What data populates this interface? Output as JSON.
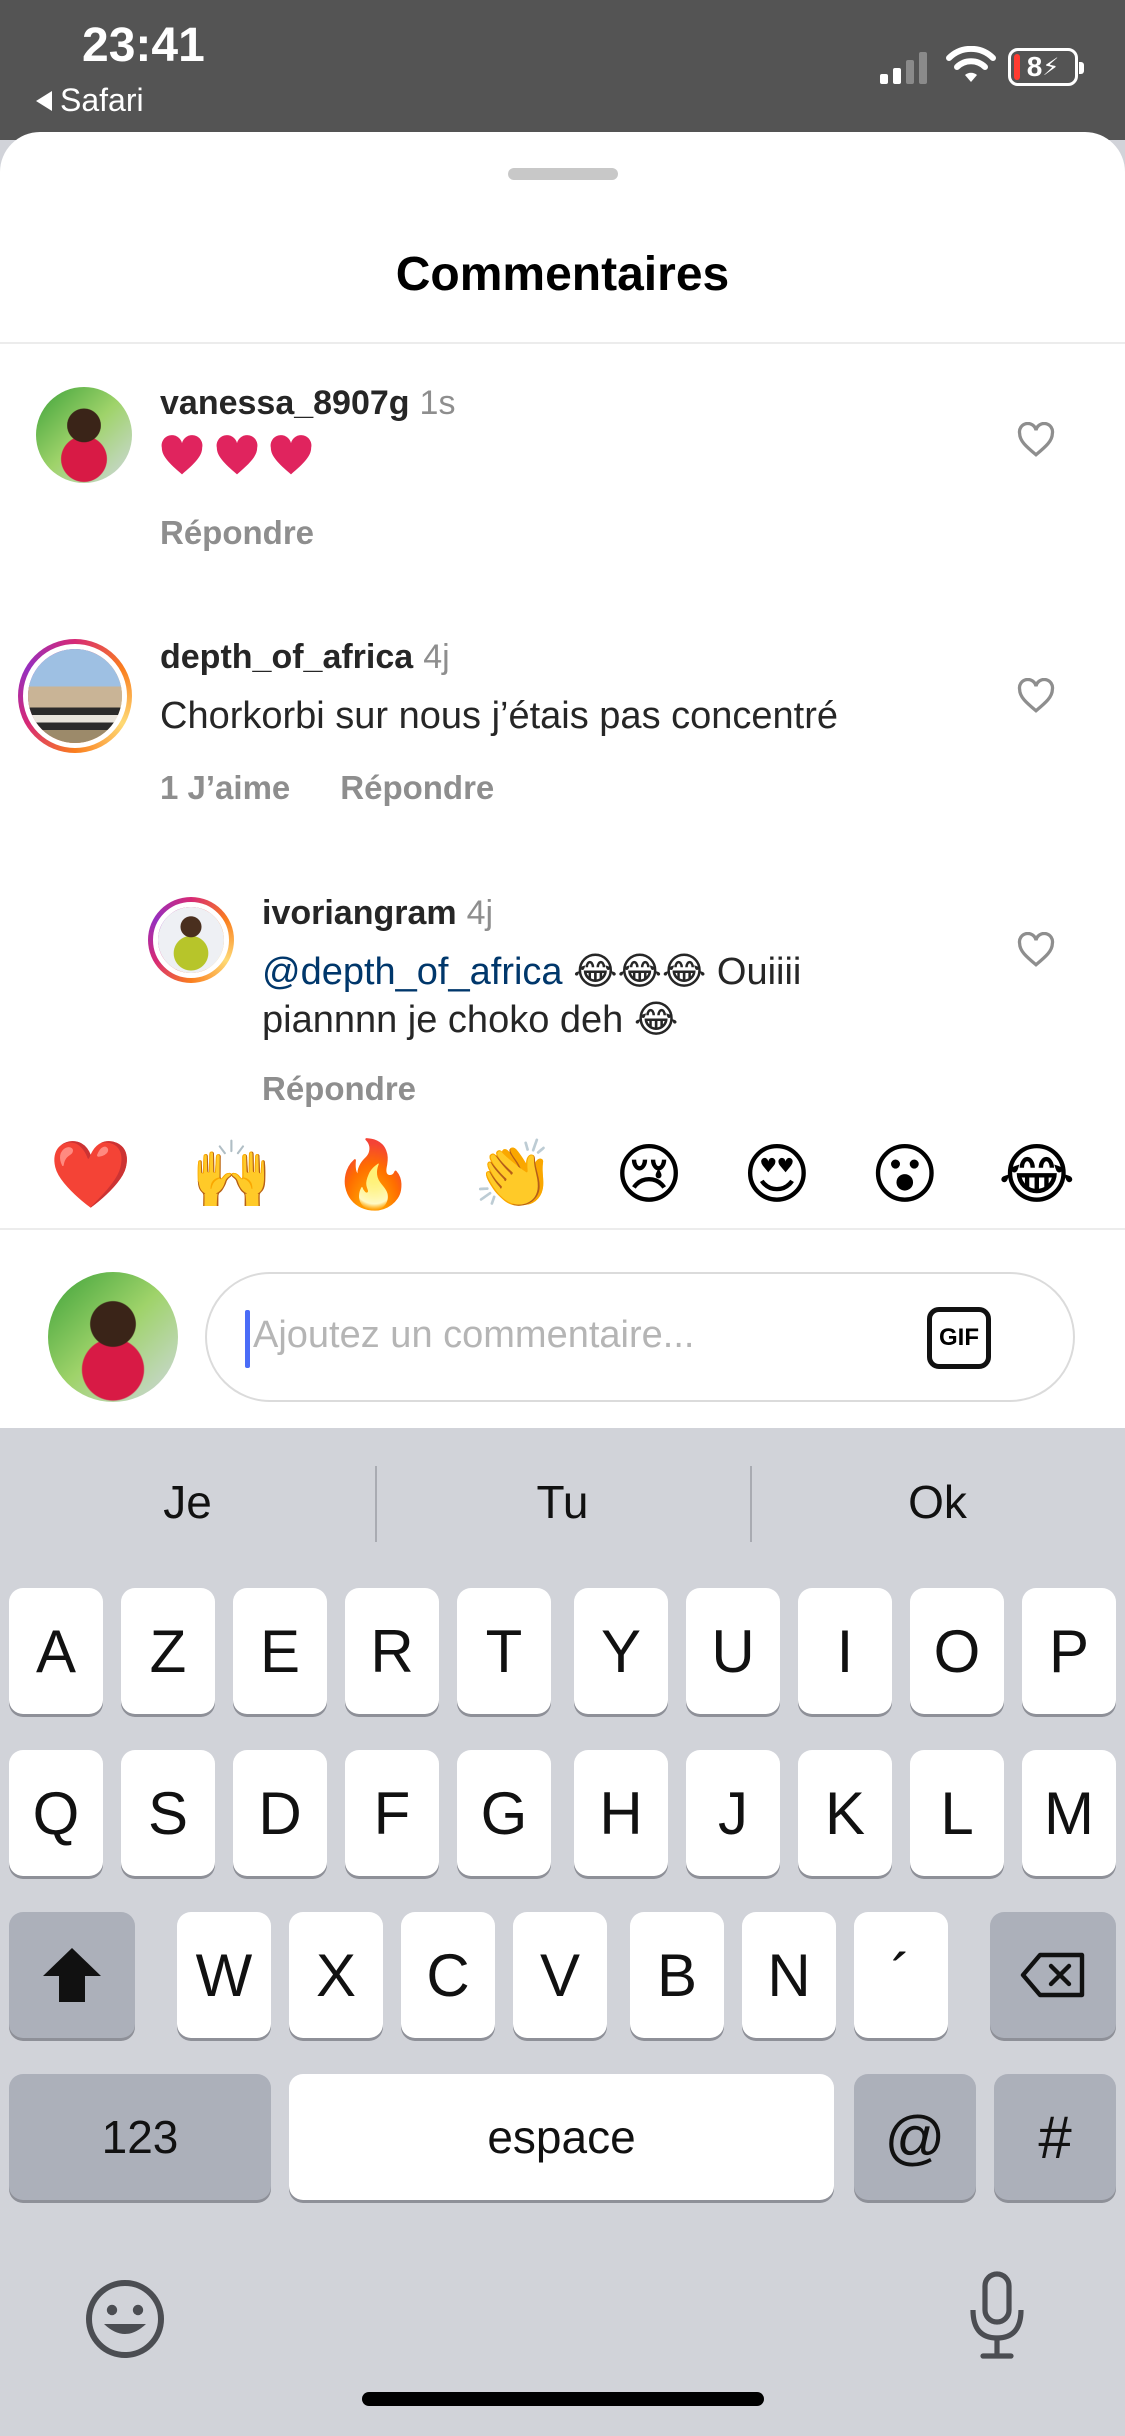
{
  "status_bar": {
    "time": "23:41",
    "back_app": "Safari",
    "battery": "8"
  },
  "sheet": {
    "title": "Commentaires"
  },
  "comments": [
    {
      "username": "vanessa_8907g",
      "time": "1s",
      "text": "",
      "hearts": 3,
      "likes": "",
      "reply": "Répondre"
    },
    {
      "username": "depth_of_africa",
      "time": "4j",
      "text": "Chorkorbi sur nous j’étais pas concentré",
      "likes": "1 J’aime",
      "reply": "Répondre"
    },
    {
      "username": "ivoriangram",
      "time": "4j",
      "mention": "@depth_of_africa",
      "text_line1": "😂😂😂 Ouiiii",
      "text_line2": "piannnn je choko deh 😂",
      "reply": "Répondre"
    }
  ],
  "reactions": [
    "❤️",
    "🙌",
    "🔥",
    "👏",
    "😢",
    "😍",
    "😮",
    "😂"
  ],
  "composer": {
    "placeholder": "Ajoutez un commentaire...",
    "gif_label": "GIF"
  },
  "keyboard": {
    "suggestions": [
      "Je",
      "Tu",
      "Ok"
    ],
    "row1": [
      "A",
      "Z",
      "E",
      "R",
      "T",
      "Y",
      "U",
      "I",
      "O",
      "P"
    ],
    "row2": [
      "Q",
      "S",
      "D",
      "F",
      "G",
      "H",
      "J",
      "K",
      "L",
      "M"
    ],
    "row3": [
      "W",
      "X",
      "C",
      "V",
      "B",
      "N",
      "´"
    ],
    "numbers_label": "123",
    "space_label": "espace",
    "at_label": "@",
    "hash_label": "#"
  },
  "colors": {
    "mention": "#00376b",
    "secondary_text": "#8e8e8e",
    "heart_red": "#e0245e",
    "keyboard_bg": "#d1d3d9"
  },
  "icons": [
    "back-triangle-icon",
    "signal-icon",
    "wifi-icon",
    "battery-icon",
    "heart-outline-icon",
    "gif-icon",
    "shift-icon",
    "backspace-icon",
    "emoji-icon",
    "microphone-icon"
  ]
}
